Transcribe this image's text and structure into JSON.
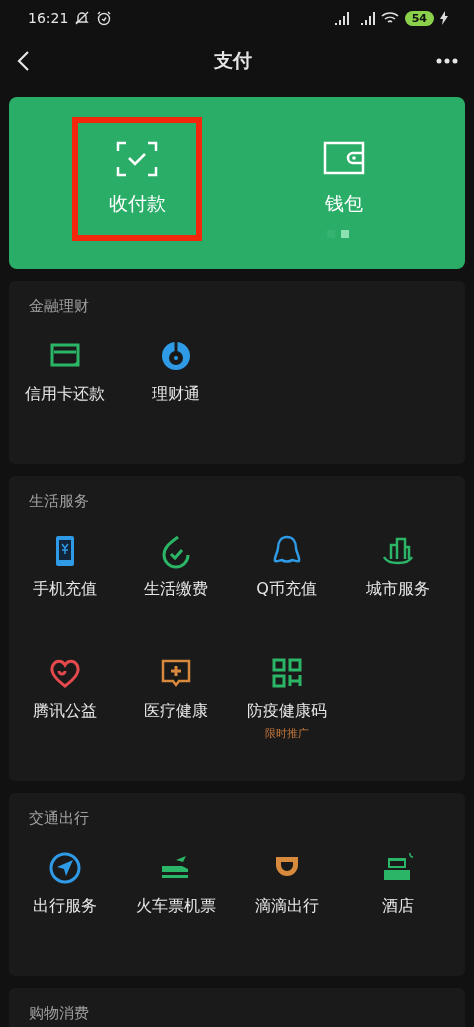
{
  "status_bar": {
    "time": "16:21",
    "battery": "54"
  },
  "header": {
    "title": "支付"
  },
  "top_card": {
    "items": [
      {
        "label": "收付款",
        "highlighted": true
      },
      {
        "label": "钱包",
        "highlighted": false
      }
    ],
    "pager": [
      {
        "selected": false
      },
      {
        "selected": true
      }
    ]
  },
  "sections": [
    {
      "title": "金融理财",
      "items": [
        {
          "label": "信用卡还款"
        },
        {
          "label": "理财通"
        }
      ]
    },
    {
      "title": "生活服务",
      "items": [
        {
          "label": "手机充值"
        },
        {
          "label": "生活缴费"
        },
        {
          "label": "Q币充值"
        },
        {
          "label": "城市服务"
        },
        {
          "label": "腾讯公益"
        },
        {
          "label": "医疗健康"
        },
        {
          "label": "防疫健康码",
          "badge": "限时推广"
        }
      ]
    },
    {
      "title": "交通出行",
      "items": [
        {
          "label": "出行服务"
        },
        {
          "label": "火车票机票"
        },
        {
          "label": "滴滴出行"
        },
        {
          "label": "酒店"
        }
      ]
    },
    {
      "title": "购物消费"
    }
  ]
}
